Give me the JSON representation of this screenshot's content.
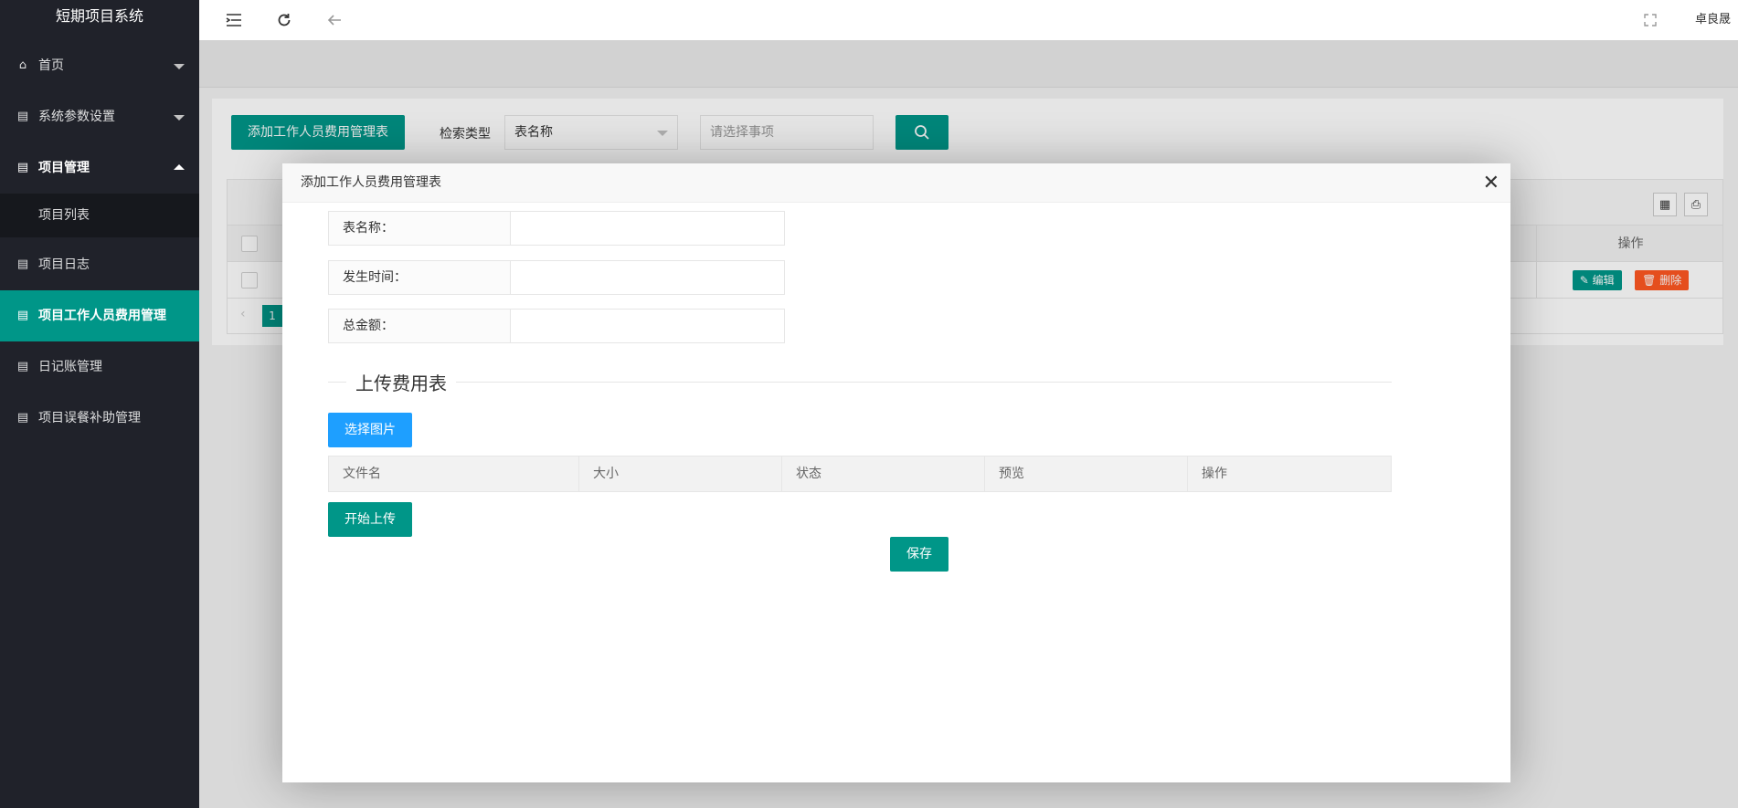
{
  "sidebar": {
    "logo": "短期项目系统",
    "items": [
      {
        "label": "首页",
        "icon": "home-icon"
      },
      {
        "label": "系统参数设置",
        "icon": "file-icon"
      },
      {
        "label": "项目管理",
        "icon": "file-icon"
      },
      {
        "label": "项目列表"
      },
      {
        "label": "项目日志",
        "icon": "file-icon"
      },
      {
        "label": "项目工作人员费用管理",
        "icon": "file-icon"
      },
      {
        "label": "日记账管理",
        "icon": "file-icon"
      },
      {
        "label": "项目误餐补助管理",
        "icon": "file-icon"
      }
    ]
  },
  "header": {
    "user_name": "卓良晟",
    "icons": [
      "menu-toggle-icon",
      "refresh-icon",
      "back-arrow-icon",
      "fullscreen-icon"
    ]
  },
  "toolbar": {
    "add_button": "添加工作人员费用管理表",
    "search_type_label": "检索类型",
    "search_type_value": "表名称",
    "search_input_placeholder": "请选择事项"
  },
  "table": {
    "op_header": "操作",
    "edit_label": "编辑",
    "delete_label": "删除",
    "page_number": "1"
  },
  "modal": {
    "title": "添加工作人员费用管理表",
    "fields": {
      "table_name_label": "表名称：",
      "occur_time_label": "发生时间：",
      "total_amount_label": "总金额："
    },
    "upload_section_title": "上传费用表",
    "choose_image_button": "选择图片",
    "upload_columns": [
      "文件名",
      "大小",
      "状态",
      "预览",
      "操作"
    ],
    "start_upload_button": "开始上传",
    "save_button": "保存"
  },
  "colors": {
    "sidebar_bg": "#20222a",
    "accent_green": "#009688",
    "accent_blue": "#1E9FFF",
    "delete_orange": "#FF5722"
  }
}
